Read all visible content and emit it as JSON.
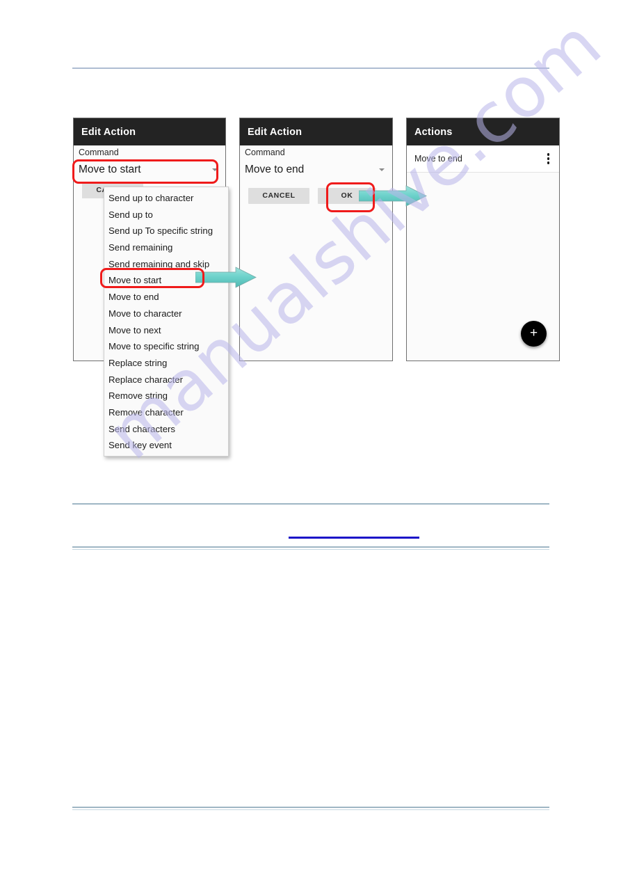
{
  "watermark": {
    "text": "manualshive.com"
  },
  "colors": {
    "appbar": "#232323",
    "highlight_ring": "#ef1b1b",
    "arrow_teal": "#6fd3cc",
    "rule_blue": "#aebdd2",
    "link_bar_blue": "#1b14c8",
    "fab": "#000000"
  },
  "panels": {
    "left": {
      "title": "Edit Action",
      "field_label": "Command",
      "spinner_value": "Move to start",
      "cancel_label": "CANCEL",
      "dropdown": {
        "items": [
          "Send up to character",
          "Send up to",
          "Send up To specific string",
          "Send remaining",
          "Send remaining and skip",
          "Move to start",
          "Move to end",
          "Move to character",
          "Move to next",
          "Move to specific string",
          "Replace string",
          "Replace character",
          "Remove string",
          "Remove character",
          "Send characters",
          "Send key event"
        ],
        "selected": "Move to start"
      }
    },
    "middle": {
      "title": "Edit Action",
      "field_label": "Command",
      "spinner_value": "Move to end",
      "cancel_label": "CANCEL",
      "ok_label": "OK"
    },
    "right": {
      "title": "Actions",
      "rows": [
        {
          "label": "Move to end",
          "menu_icon": "kebab-menu-icon"
        }
      ],
      "fab_icon": "plus-icon"
    }
  }
}
